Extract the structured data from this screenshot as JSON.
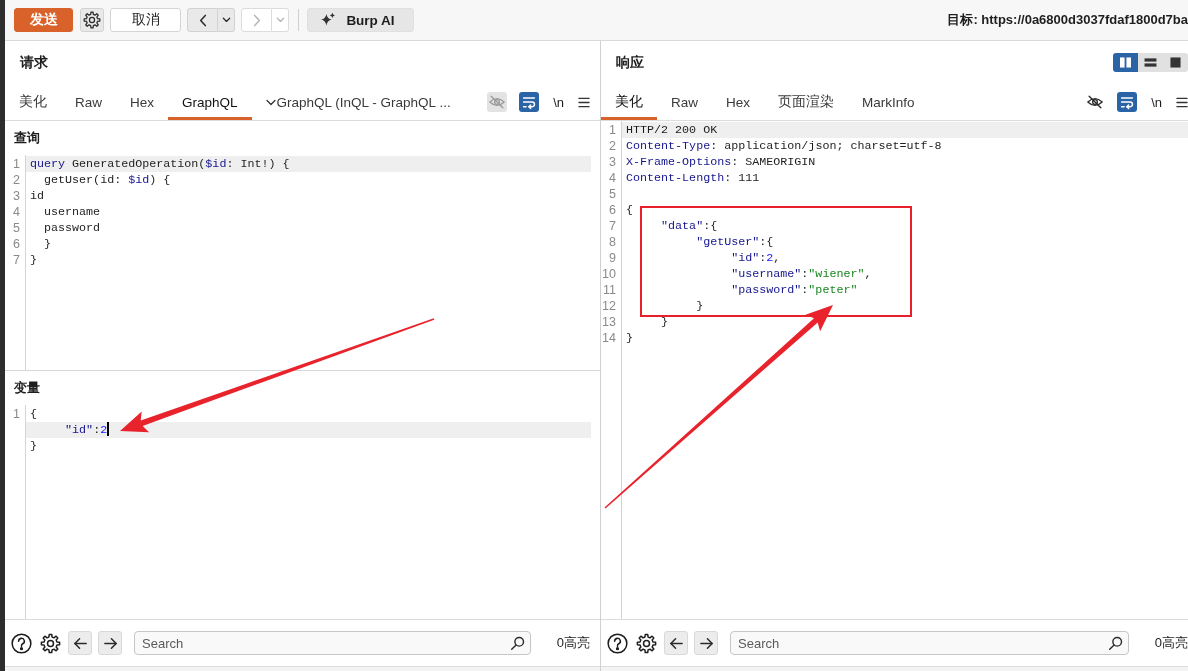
{
  "toolbar": {
    "send_label": "发送",
    "cancel_label": "取消",
    "history": [
      {
        "kind": "back",
        "disabled": false
      },
      {
        "kind": "forward",
        "disabled": true
      }
    ],
    "ai_label": "Burp AI",
    "target": "目标: https://0a6800d3037fdaf1800d7ba"
  },
  "request": {
    "title": "请求",
    "tabs": [
      {
        "label": "美化",
        "kind": "plain",
        "selected": false
      },
      {
        "label": "Raw",
        "kind": "plain",
        "selected": false
      },
      {
        "label": "Hex",
        "kind": "plain",
        "selected": false
      },
      {
        "label": "GraphQL",
        "kind": "plain",
        "selected": true
      },
      {
        "label": "GraphQL (InQL - GraphQL ...",
        "kind": "dropdown",
        "selected": false
      }
    ],
    "tools": [
      {
        "kind": "eye",
        "disabled": true
      },
      {
        "kind": "wrap",
        "on": true
      },
      {
        "kind": "newline",
        "label": "\\n"
      },
      {
        "kind": "menu"
      }
    ],
    "sections": [
      {
        "title": "查询",
        "lines": [
          {
            "number": "1",
            "current": true,
            "tokens": [
              {
                "text": "query",
                "kind": "keyword"
              },
              {
                "text": " GeneratedOperation(",
                "kind": "plain"
              },
              {
                "text": "$id",
                "kind": "variable"
              },
              {
                "text": ": Int!) {",
                "kind": "plain"
              }
            ]
          },
          {
            "number": "2",
            "current": false,
            "tokens": [
              {
                "text": "  getUser(id: ",
                "kind": "plain"
              },
              {
                "text": "$id",
                "kind": "variable"
              },
              {
                "text": ") {",
                "kind": "plain"
              }
            ]
          },
          {
            "number": "3",
            "current": false,
            "tokens": [
              {
                "text": "id",
                "kind": "plain"
              }
            ]
          },
          {
            "number": "4",
            "current": false,
            "tokens": [
              {
                "text": "  username",
                "kind": "plain"
              }
            ]
          },
          {
            "number": "5",
            "current": false,
            "tokens": [
              {
                "text": "  password",
                "kind": "plain"
              }
            ]
          },
          {
            "number": "6",
            "current": false,
            "tokens": [
              {
                "text": "  }",
                "kind": "plain"
              }
            ]
          },
          {
            "number": "7",
            "current": false,
            "tokens": [
              {
                "text": "}",
                "kind": "plain"
              }
            ]
          }
        ]
      },
      {
        "title": "变量",
        "cursor": true,
        "lines": [
          {
            "number": "1",
            "current": false,
            "tokens": [
              {
                "text": "{",
                "kind": "plain"
              }
            ]
          },
          {
            "current": true,
            "tokens": [
              {
                "text": "     \"id\"",
                "kind": "key"
              },
              {
                "text": ":",
                "kind": "plain"
              },
              {
                "text": "2",
                "kind": "number"
              }
            ]
          },
          {
            "current": false,
            "tokens": [
              {
                "text": "}",
                "kind": "plain"
              }
            ]
          }
        ]
      }
    ],
    "find_bar": {
      "placeholder": "Search",
      "matches": "0高亮"
    }
  },
  "response": {
    "title": "响应",
    "layout_buttons": [
      {
        "kind": "columns",
        "selected": true
      },
      {
        "kind": "rows",
        "selected": false
      },
      {
        "kind": "single",
        "selected": false
      }
    ],
    "tabs": [
      {
        "label": "美化",
        "kind": "plain",
        "selected": true
      },
      {
        "label": "Raw",
        "kind": "plain",
        "selected": false
      },
      {
        "label": "Hex",
        "kind": "plain",
        "selected": false
      },
      {
        "label": "页面渲染",
        "kind": "plain",
        "selected": false
      },
      {
        "label": "MarkInfo",
        "kind": "plain",
        "selected": false
      }
    ],
    "tools": [
      {
        "kind": "eye",
        "disabled": false
      },
      {
        "kind": "wrap",
        "on": true
      },
      {
        "kind": "newline",
        "label": "\\n"
      },
      {
        "kind": "menu"
      }
    ],
    "editor": {
      "lines": [
        {
          "number": "1",
          "current": true,
          "tokens": [
            {
              "text": "HTTP/2 200 OK",
              "kind": "plain"
            }
          ]
        },
        {
          "number": "2",
          "current": false,
          "tokens": [
            {
              "text": "Content-Type",
              "kind": "header"
            },
            {
              "text": ": application/json; charset=utf-8",
              "kind": "plain"
            }
          ]
        },
        {
          "number": "3",
          "current": false,
          "tokens": [
            {
              "text": "X-Frame-Options",
              "kind": "header"
            },
            {
              "text": ": SAMEORIGIN",
              "kind": "plain"
            }
          ]
        },
        {
          "number": "4",
          "current": false,
          "tokens": [
            {
              "text": "Content-Length",
              "kind": "header"
            },
            {
              "text": ": 111",
              "kind": "plain"
            }
          ]
        },
        {
          "number": "5",
          "current": false
        },
        {
          "number": "6",
          "current": false,
          "tokens": [
            {
              "text": "{",
              "kind": "plain"
            }
          ]
        },
        {
          "number": "7",
          "current": false,
          "tokens": [
            {
              "text": "     \"data\"",
              "kind": "key"
            },
            {
              "text": ":{",
              "kind": "plain"
            }
          ]
        },
        {
          "number": "8",
          "current": false,
          "tokens": [
            {
              "text": "          \"getUser\"",
              "kind": "key"
            },
            {
              "text": ":{",
              "kind": "plain"
            }
          ]
        },
        {
          "number": "9",
          "current": false,
          "tokens": [
            {
              "text": "               \"id\"",
              "kind": "key"
            },
            {
              "text": ":",
              "kind": "plain"
            },
            {
              "text": "2",
              "kind": "number"
            },
            {
              "text": ",",
              "kind": "plain"
            }
          ]
        },
        {
          "number": "10",
          "current": false,
          "tokens": [
            {
              "text": "               \"username\"",
              "kind": "key"
            },
            {
              "text": ":",
              "kind": "plain"
            },
            {
              "text": "\"wiener\"",
              "kind": "string"
            },
            {
              "text": ",",
              "kind": "plain"
            }
          ]
        },
        {
          "number": "11",
          "current": false,
          "tokens": [
            {
              "text": "               \"password\"",
              "kind": "key"
            },
            {
              "text": ":",
              "kind": "plain"
            },
            {
              "text": "\"peter\"",
              "kind": "string"
            }
          ]
        },
        {
          "number": "12",
          "current": false,
          "tokens": [
            {
              "text": "          }",
              "kind": "plain"
            }
          ]
        },
        {
          "number": "13",
          "current": false,
          "tokens": [
            {
              "text": "     }",
              "kind": "plain"
            }
          ]
        },
        {
          "number": "14",
          "current": false,
          "tokens": [
            {
              "text": "}",
              "kind": "plain"
            }
          ]
        }
      ]
    },
    "find_bar": {
      "placeholder": "Search",
      "matches": "0高亮"
    }
  },
  "annotations": [
    {
      "kind": "frame"
    },
    {
      "kind": "arrow"
    },
    {
      "kind": "arrow"
    }
  ]
}
